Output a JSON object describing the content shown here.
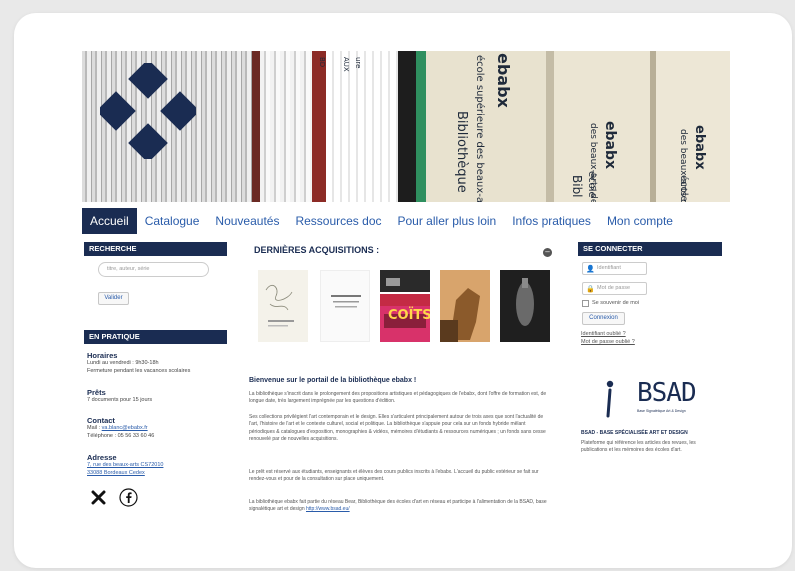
{
  "banner": {
    "spine_texts": [
      "Bibliothèque",
      "ebabx",
      "école supérieure des beaux-arts de Borde",
      "ebabx",
      "école",
      "des beaux-arts de",
      "Bibl",
      "ebabx",
      "école",
      "des beaux-arts d"
    ],
    "small_spine": [
      "ure",
      "AUX",
      "BD"
    ]
  },
  "nav": {
    "items": [
      "Accueil",
      "Catalogue",
      "Nouveautés",
      "Ressources doc",
      "Pour aller plus loin",
      "Infos pratiques",
      "Mon compte"
    ]
  },
  "left": {
    "search_title": "RECHERCHE",
    "search_placeholder": "titre, auteur, série",
    "search_button": "Valider",
    "practice_title": "EN PRATIQUE",
    "hours_title": "Horaires",
    "hours_line1": "Lundi au vendredi : 9h30-18h",
    "hours_line2": "Fermeture pendant les vacances scolaires",
    "loans_title": "Prêts",
    "loans_line": "7 documents pour 15 jours",
    "contact_title": "Contact",
    "contact_mail_label": "Mail : ",
    "contact_mail": "va.blanc@ebabx.fr",
    "contact_phone": "Téléphone : 05 56 33 60 46",
    "address_title": "Adresse",
    "address_line1": "7, rue des beaux-arts CS72010",
    "address_line2": "33088 Bordeaux Cedex"
  },
  "social": {
    "x_icon": "x-icon",
    "facebook_icon": "facebook-icon"
  },
  "center": {
    "acquisitions_title": "DERNIÈRES ACQUISITIONS :",
    "cover_text_4": "COÏTS",
    "welcome_title": "Bienvenue sur le portail de la bibliothèque ebabx !",
    "p1": "La bibliothèque s'inscrit dans le prolongement des propositions artistiques et pédagogiques de l'ebabx, dont l'offre de formation est, de longue date, très largement imprégnée par les questions d'édition.",
    "p2": "Ses collections privilégient l'art contemporain et le design. Elles s'articulent principalement autour de trois axes que sont l'actualité de l'art, l'histoire de l'art et le contexte culturel, social et politique. La bibliothèque s'appuie pour cela sur un fonds hybride mêlant périodiques & catalogues d'exposition, monographies & vidéos, mémoires d'étudiants & ressources numériques ; un fonds sans cesse renouvelé par de nouvelles acquisitions.",
    "p3": "Le prêt est réservé aux étudiants, enseignants et élèves des cours publics inscrits à l'ebabx. L'accueil du public extérieur se fait sur rendez-vous et pour de la consultation sur place uniquement.",
    "p4": "La bibliothèque ebabx fait partie du réseau Bear, Bibliothèque des écoles d'art en réseau et participe à l'alimentation de la BSAD, base signalétique art et design ",
    "p4_link": "http://www.bsad.eu/"
  },
  "right": {
    "login_title": "SE CONNECTER",
    "id_placeholder": "Identifiant",
    "pw_placeholder": "Mot de passe",
    "remember": "Se souvenir de moi",
    "connect_button": "Connexion",
    "forgot_id": "Identifiant oublié ?",
    "forgot_pw": "Mot de passe oublié ?",
    "bsad_logo_text": "BSAD",
    "bsad_logo_sub": "Base Signalétique Art & Design",
    "bsad_title": "BSAD - BASE SPÉCIALISÉE ART ET DESIGN",
    "bsad_desc": "Plateforme qui référence les articles des revues, les publications et les mémoires des écoles d'art."
  },
  "colors": {
    "navy": "#1a2c52",
    "link": "#2a5caa"
  }
}
